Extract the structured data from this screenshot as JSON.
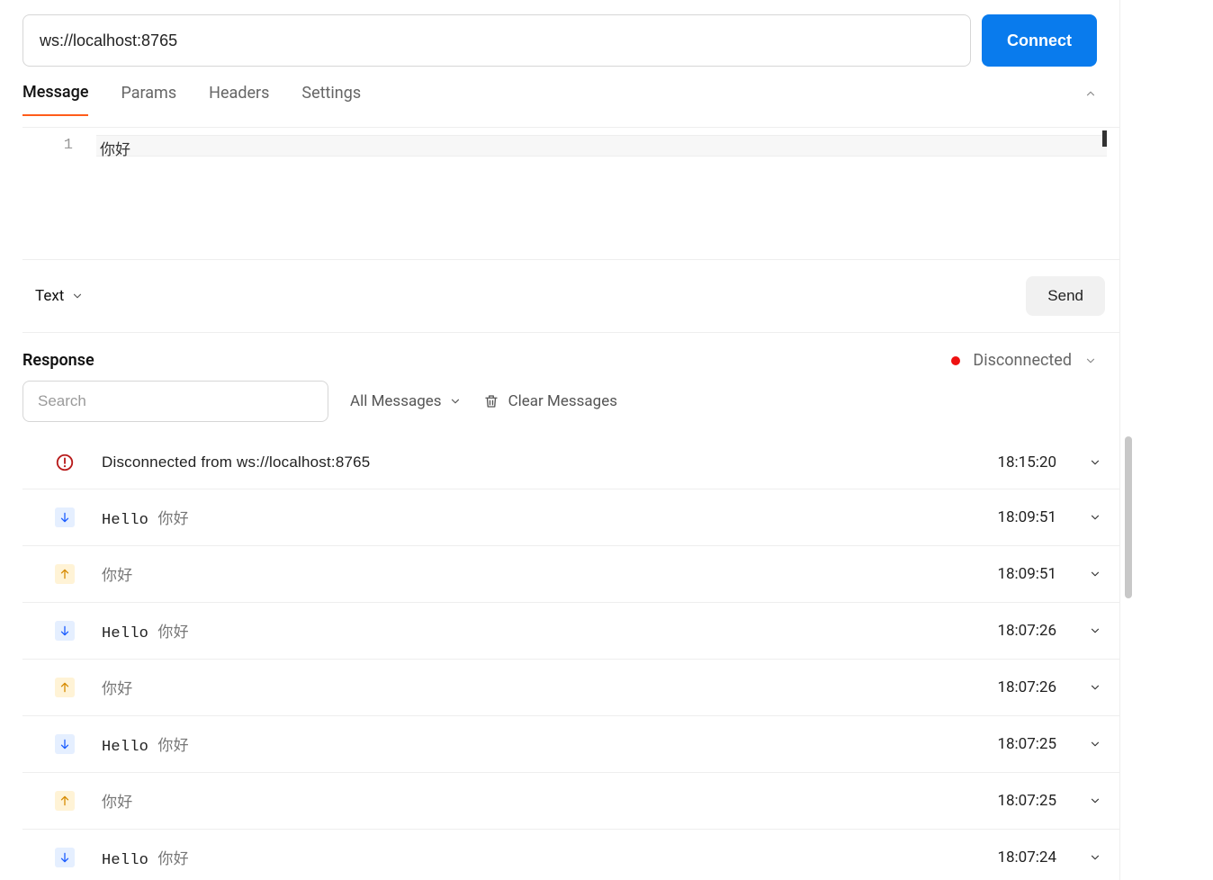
{
  "url": "ws://localhost:8765",
  "connect_label": "Connect",
  "tabs": {
    "message": "Message",
    "params": "Params",
    "headers": "Headers",
    "settings": "Settings"
  },
  "editor": {
    "line_number": "1",
    "content": "你好"
  },
  "format_label": "Text",
  "send_label": "Send",
  "response": {
    "title": "Response",
    "status_text": "Disconnected"
  },
  "filters": {
    "search_placeholder": "Search",
    "all_messages": "All Messages",
    "clear_messages": "Clear Messages"
  },
  "messages": [
    {
      "type": "error",
      "text_en": "Disconnected from ws://localhost:8765",
      "text_cn": "",
      "time": "18:15:20"
    },
    {
      "type": "down",
      "text_en": "Hello ",
      "text_cn": "你好",
      "time": "18:09:51"
    },
    {
      "type": "up",
      "text_en": "",
      "text_cn": "你好",
      "time": "18:09:51"
    },
    {
      "type": "down",
      "text_en": "Hello ",
      "text_cn": "你好",
      "time": "18:07:26"
    },
    {
      "type": "up",
      "text_en": "",
      "text_cn": "你好",
      "time": "18:07:26"
    },
    {
      "type": "down",
      "text_en": "Hello ",
      "text_cn": "你好",
      "time": "18:07:25"
    },
    {
      "type": "up",
      "text_en": "",
      "text_cn": "你好",
      "time": "18:07:25"
    },
    {
      "type": "down",
      "text_en": "Hello ",
      "text_cn": "你好",
      "time": "18:07:24"
    }
  ]
}
